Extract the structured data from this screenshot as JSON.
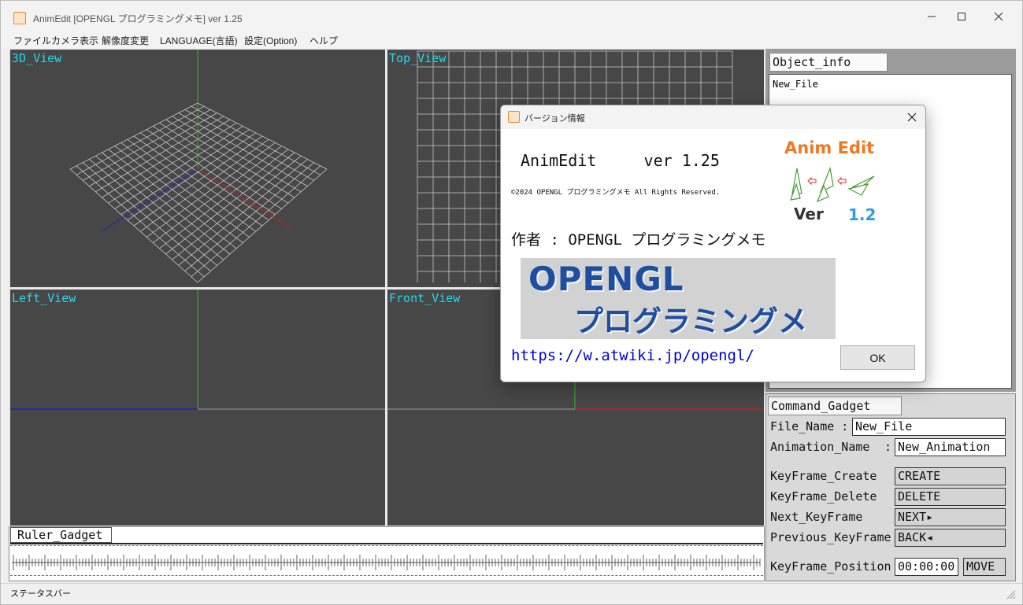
{
  "window": {
    "title": "AnimEdit [OPENGL プログラミングメモ] ver 1.25",
    "icon_text": "Anim Edit"
  },
  "menu": [
    "ファイル",
    "カメラ表示",
    "解像度変更",
    "LANGUAGE(言語)",
    "設定(Option)",
    "ヘルプ"
  ],
  "views": {
    "view_3d": "3D_View",
    "view_top": "Top_View",
    "view_left": "Left_View",
    "view_front": "Front_View"
  },
  "object_info": {
    "tab": "Object_info",
    "items": [
      "New_File"
    ]
  },
  "command_gadget": {
    "tab": "Command_Gadget",
    "file_name_label": "File_Name :",
    "file_name_value": "New_File",
    "animation_name_label": "Animation_Name",
    "animation_name_colon": ":",
    "animation_name_value": "New_Animation",
    "keyframe_create_label": "KeyFrame_Create",
    "keyframe_create_btn": "CREATE",
    "keyframe_delete_label": "KeyFrame_Delete",
    "keyframe_delete_btn": "DELETE",
    "next_keyframe_label": "Next_KeyFrame",
    "next_keyframe_btn": "NEXT▸",
    "previous_keyframe_label": "Previous_KeyFrame",
    "previous_keyframe_btn": "BACK◂",
    "keyframe_position_label": "KeyFrame_Position",
    "keyframe_position_value": "00:00:00",
    "move_btn": "MOVE"
  },
  "ruler": {
    "tab": "Ruler_Gadget"
  },
  "status_bar": "ステータスバー",
  "dialog": {
    "title": "バージョン情報",
    "app_name_line": "AnimEdit     ver 1.25",
    "copyright": "©2024 OPENGL プログラミングメモ All Rights Reserved.",
    "author": "作者 : OPENGL プログラミングメモ",
    "banner_line1": "OPENGL",
    "banner_line2": "プログラミングメモ",
    "logo_title": "Anim Edit",
    "logo_ver": "Ver",
    "logo_num": "1.2",
    "url": "https://w.atwiki.jp/opengl/",
    "ok_button": "OK"
  },
  "colors": {
    "viewport_bg": "#474747",
    "view_label": "#22d8f0",
    "axis_x": "#c81e1e",
    "axis_y": "#1ec81e",
    "axis_z": "#1e1ec8",
    "grid": "#c8c8c8",
    "url": "#0000d8",
    "logo_orange": "#f07820",
    "logo_blue": "#2aa0e0"
  }
}
